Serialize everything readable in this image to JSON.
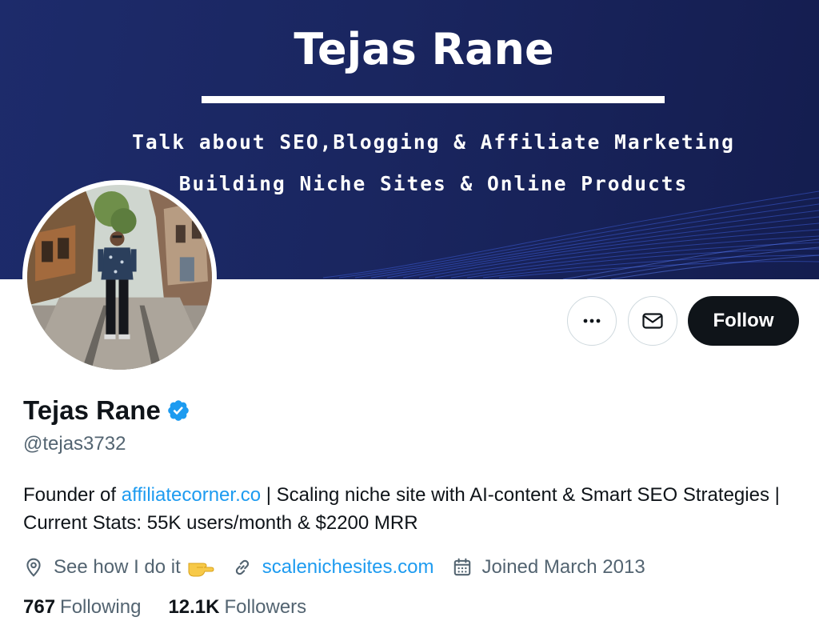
{
  "banner": {
    "title": "Tejas Rane",
    "line1": "Talk about SEO,Blogging & Affiliate Marketing",
    "line2": "Building Niche Sites & Online Products",
    "colors": {
      "background": "#1a2660",
      "text": "#ffffff"
    }
  },
  "profile": {
    "avatar_icon": "profile-photo",
    "display_name": "Tejas Rane",
    "verified_icon": "verified-badge-icon",
    "handle": "@tejas3732",
    "bio": {
      "prefix": "Founder of ",
      "link_text": "affiliatecorner.co",
      "suffix": " | Scaling niche site with AI-content & Smart SEO Strategies | Current Stats: 55K users/month & $2200 MRR"
    },
    "meta": {
      "location_icon": "location-pin-icon",
      "location": "See how I do it",
      "location_emoji": "pointing-hand-emoji",
      "website_icon": "link-icon",
      "website": "scalenichesites.com",
      "joined_icon": "calendar-icon",
      "joined": "Joined March 2013"
    },
    "stats": {
      "following_count": "767",
      "following_label": "Following",
      "followers_count": "12.1K",
      "followers_label": "Followers"
    }
  },
  "actions": {
    "more_icon": "more-icon",
    "message_icon": "mail-icon",
    "follow_label": "Follow"
  },
  "colors": {
    "link": "#1d9bf0",
    "secondary_text": "#536471",
    "primary_text": "#0f1419",
    "follow_button": "#0f1419",
    "verified": "#1d9bf0"
  }
}
